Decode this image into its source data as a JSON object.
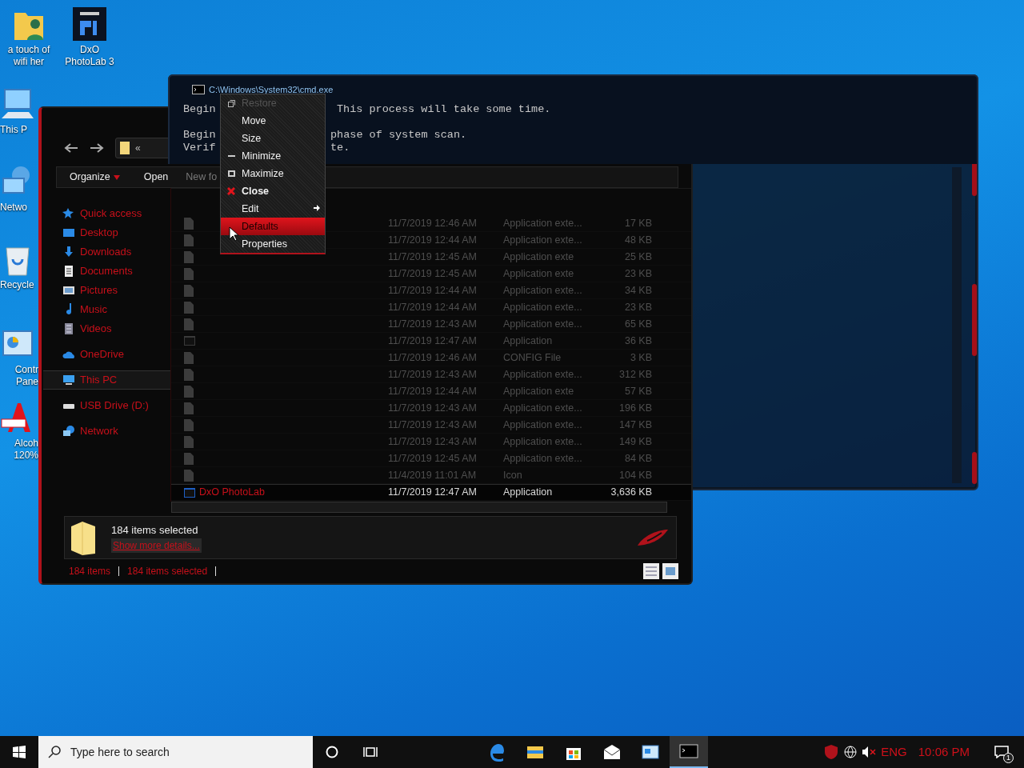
{
  "desktop_icons": [
    {
      "label": "a touch of wifi her",
      "kind": "folder"
    },
    {
      "label": "DxO PhotoLab 3",
      "kind": "tile"
    },
    {
      "label": "This P",
      "kind": "monitor"
    },
    {
      "label": "Netwo",
      "kind": "network"
    },
    {
      "label": "Recycle",
      "kind": "bin"
    },
    {
      "label": "Contr Pane",
      "kind": "panel"
    },
    {
      "label": "Alcoh 120%",
      "kind": "letter"
    }
  ],
  "explorer": {
    "address_chevron": "«",
    "toolbar": [
      {
        "label": "Organize",
        "dropdown": true
      },
      {
        "label": "Open",
        "dropdown": false
      },
      {
        "label": "New fo",
        "dropdown": false
      }
    ],
    "nav_items": [
      {
        "label": "Quick access",
        "kind": "star",
        "selected": false
      },
      {
        "label": "Desktop",
        "kind": "desktop",
        "selected": false
      },
      {
        "label": "Downloads",
        "kind": "download",
        "selected": false
      },
      {
        "label": "Documents",
        "kind": "document",
        "selected": false
      },
      {
        "label": "Pictures",
        "kind": "picture",
        "selected": false
      },
      {
        "label": "Music",
        "kind": "music",
        "selected": false
      },
      {
        "label": "Videos",
        "kind": "video",
        "selected": false
      },
      {
        "label": "OneDrive",
        "kind": "cloud",
        "selected": false
      },
      {
        "label": "This PC",
        "kind": "monitor",
        "selected": true
      },
      {
        "label": "USB Drive (D:)",
        "kind": "drive",
        "selected": false
      },
      {
        "label": "Network",
        "kind": "network",
        "selected": false
      }
    ],
    "rows": [
      {
        "kind": "file",
        "date": "11/7/2019 12:46 AM",
        "type": "Application exte...",
        "size": "17 KB",
        "selected": false
      },
      {
        "kind": "file",
        "date": "11/7/2019 12:44 AM",
        "type": "Application exte...",
        "size": "48 KB",
        "selected": false
      },
      {
        "kind": "file",
        "date": "11/7/2019 12:45 AM",
        "type": "Application exte",
        "size": "25 KB",
        "selected": false
      },
      {
        "kind": "file",
        "date": "11/7/2019 12:45 AM",
        "type": "Application exte",
        "size": "23 KB",
        "selected": false
      },
      {
        "kind": "file",
        "date": "11/7/2019 12:44 AM",
        "type": "Application exte...",
        "size": "34 KB",
        "selected": false
      },
      {
        "kind": "file",
        "date": "11/7/2019 12:44 AM",
        "type": "Application exte...",
        "size": "23 KB",
        "selected": false
      },
      {
        "kind": "file",
        "date": "11/7/2019 12:43 AM",
        "type": "Application exte...",
        "size": "65 KB",
        "selected": false
      },
      {
        "kind": "app",
        "date": "11/7/2019 12:47 AM",
        "type": "Application",
        "size": "36 KB",
        "selected": false
      },
      {
        "kind": "file",
        "date": "11/7/2019 12:46 AM",
        "type": "CONFIG File",
        "size": "3 KB",
        "selected": false
      },
      {
        "kind": "file",
        "date": "11/7/2019 12:43 AM",
        "type": "Application exte...",
        "size": "312 KB",
        "selected": false
      },
      {
        "kind": "file",
        "date": "11/7/2019 12:44 AM",
        "type": "Application exte",
        "size": "57 KB",
        "selected": false
      },
      {
        "kind": "file",
        "date": "11/7/2019 12:43 AM",
        "type": "Application exte...",
        "size": "196 KB",
        "selected": false
      },
      {
        "kind": "file",
        "date": "11/7/2019 12:43 AM",
        "type": "Application exte...",
        "size": "147 KB",
        "selected": false
      },
      {
        "kind": "file",
        "date": "11/7/2019 12:43 AM",
        "type": "Application exte...",
        "size": "149 KB",
        "selected": false
      },
      {
        "kind": "file",
        "date": "11/7/2019 12:45 AM",
        "type": "Application exte...",
        "size": "84 KB",
        "selected": false
      },
      {
        "kind": "file",
        "date": "11/4/2019 11:01 AM",
        "type": "Icon",
        "size": "104 KB",
        "selected": false
      },
      {
        "kind": "app",
        "name": "DxO PhotoLab",
        "date": "11/7/2019 12:47 AM",
        "type": "Application",
        "size": "3,636 KB",
        "selected": true
      }
    ],
    "details": {
      "title": "184 items selected",
      "link": "Show more details..."
    },
    "status": [
      "184 items",
      "184 items selected"
    ]
  },
  "cmd": {
    "title": "C:\\Windows\\System32\\cmd.exe",
    "lines": [
      {
        "left": "Begin",
        "right": "This process will take some time."
      },
      {
        "left": "Begin",
        "right": "phase of system scan."
      },
      {
        "left": "Verif",
        "right": "te."
      }
    ],
    "menu": [
      {
        "label": "Restore",
        "kind": "restore",
        "disabled": true,
        "selected": false
      },
      {
        "label": "Move",
        "kind": "plain",
        "disabled": false,
        "selected": false
      },
      {
        "label": "Size",
        "kind": "plain",
        "disabled": false,
        "selected": false
      },
      {
        "label": "Minimize",
        "kind": "minimize",
        "disabled": false,
        "selected": false
      },
      {
        "label": "Maximize",
        "kind": "maximize",
        "disabled": false,
        "selected": false
      },
      {
        "label": "Close",
        "kind": "close",
        "disabled": false,
        "selected": false
      },
      {
        "label": "Edit",
        "kind": "submenu",
        "disabled": false,
        "selected": false
      },
      {
        "label": "Defaults",
        "kind": "plain",
        "disabled": false,
        "selected": true
      },
      {
        "label": "Properties",
        "kind": "plain",
        "disabled": false,
        "selected": false
      }
    ]
  },
  "taskbar": {
    "search": {
      "placeholder": "Type here to search"
    },
    "apps": [
      {
        "kind": "edge",
        "selected": false
      },
      {
        "kind": "explorer",
        "selected": false
      },
      {
        "kind": "store",
        "selected": false
      },
      {
        "kind": "mail",
        "selected": false
      },
      {
        "kind": "panel",
        "selected": false
      },
      {
        "kind": "terminal",
        "selected": true
      }
    ],
    "language": "ENG",
    "time": "10:06 PM",
    "notifications": "1"
  }
}
